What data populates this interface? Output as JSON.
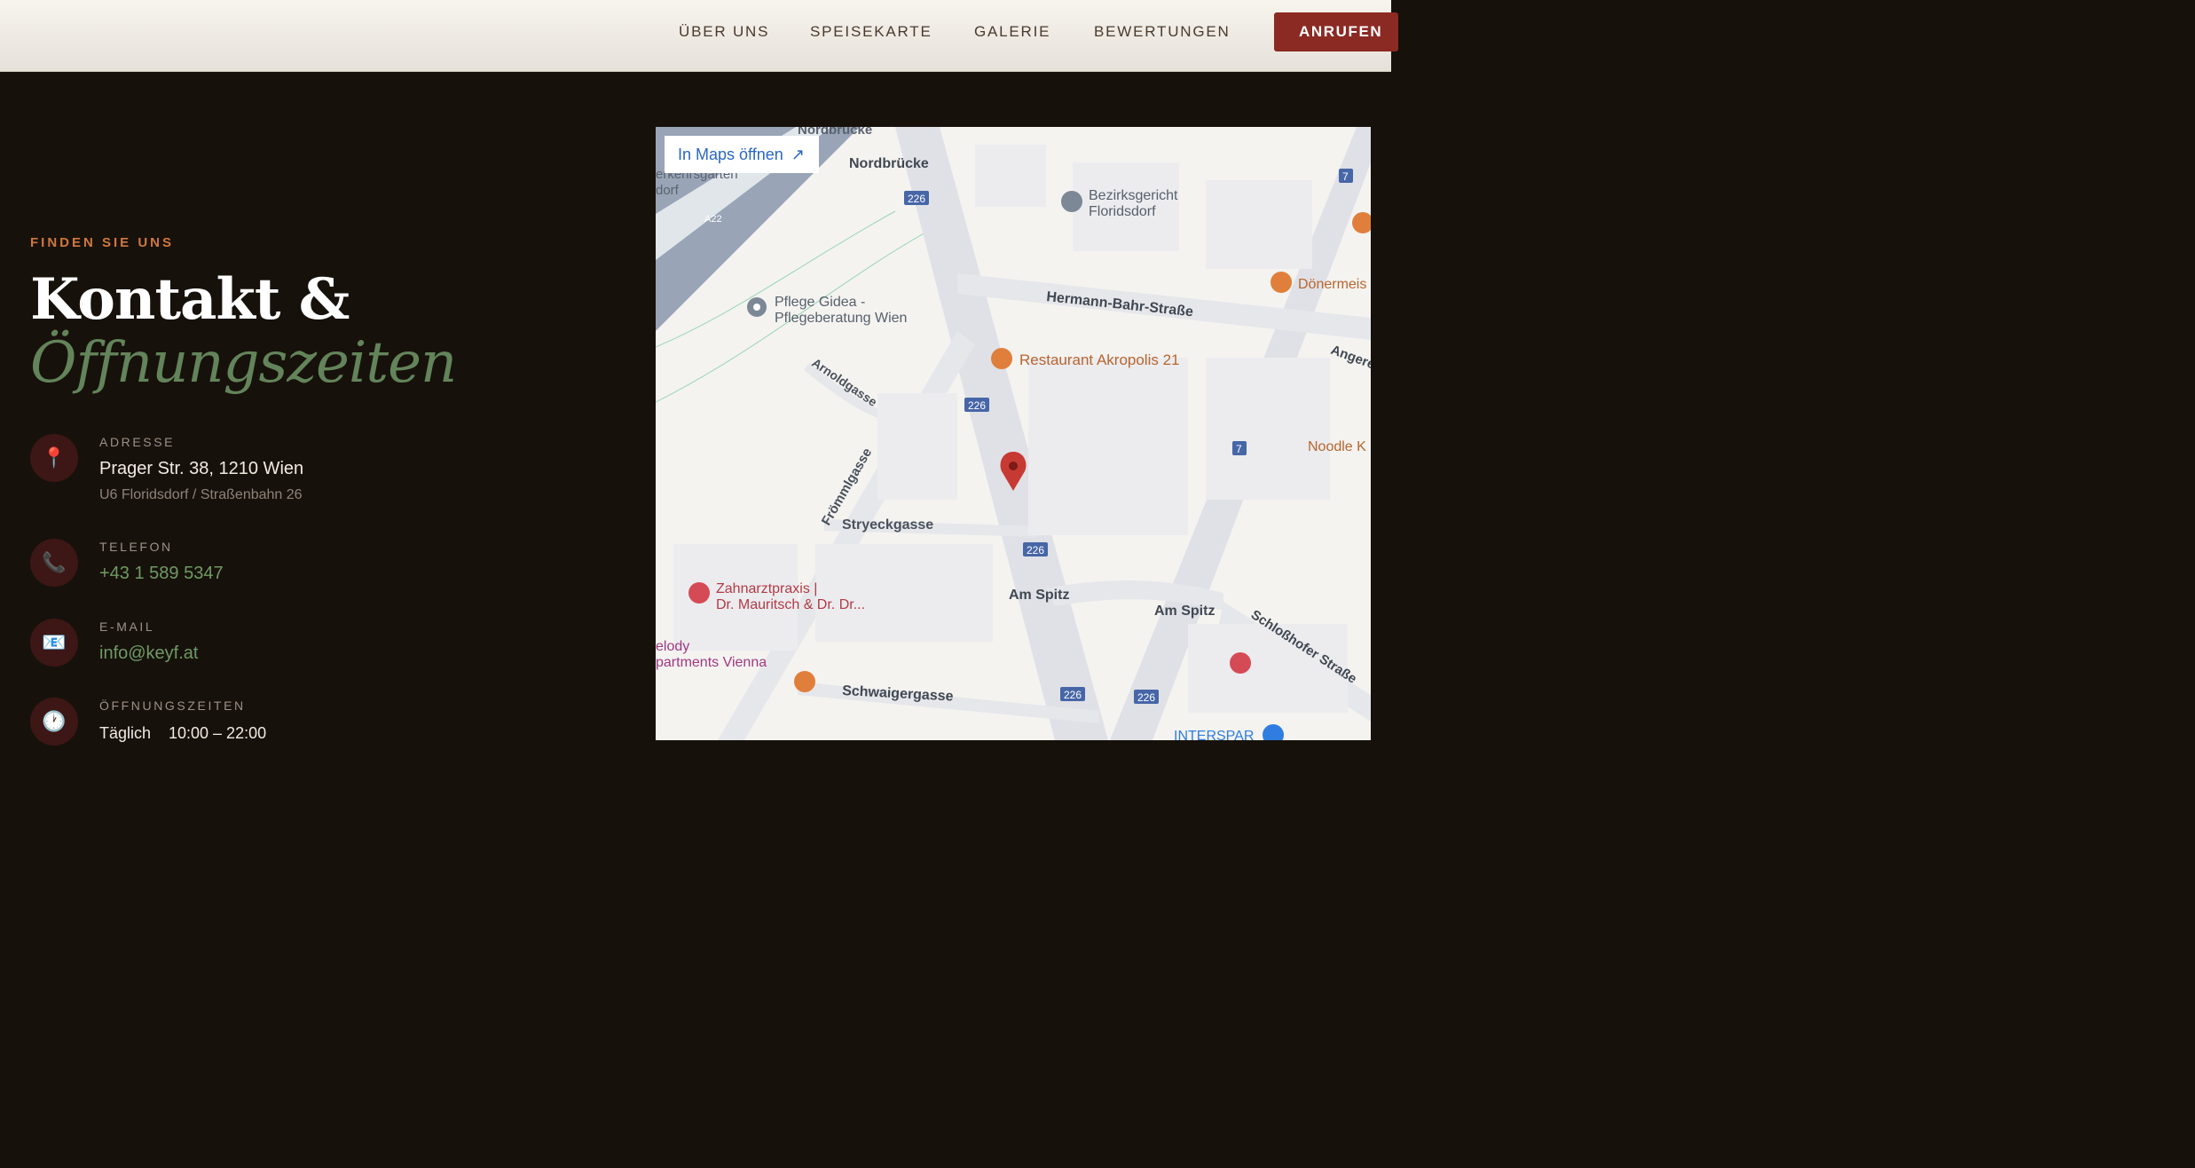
{
  "nav": {
    "items": [
      "ÜBER UNS",
      "SPEISEKARTE",
      "GALERIE",
      "BEWERTUNGEN"
    ],
    "call_label": "ANRUFEN"
  },
  "contact": {
    "eyebrow": "FINDEN SIE UNS",
    "title_main": "Kontakt &",
    "title_accent": "Öffnungszeiten",
    "address": {
      "label": "ADRESSE",
      "value": "Prager Str. 38, 1210 Wien",
      "sub": "U6 Floridsdorf / Straßenbahn 26",
      "icon": "location-pin-icon"
    },
    "phone": {
      "label": "TELEFON",
      "value": "+43 1 589 5347",
      "icon": "phone-icon"
    },
    "email": {
      "label": "E-MAIL",
      "value": "info@keyf.at",
      "icon": "email-icon"
    },
    "hours": {
      "label": "ÖFFNUNGSZEITEN",
      "day": "Täglich",
      "time": "10:00 – 22:00",
      "icon": "clock-icon"
    }
  },
  "map": {
    "open_label": "In Maps öffnen",
    "labels": [
      "Nordbrücke",
      "Nordbrücke",
      "erkehrsgarten",
      "dorf",
      "A22",
      "Bezirksgericht",
      "Floridsdorf",
      "Pflege Gidea -",
      "Pflegeberatung Wien",
      "Hermann-Bahr-Straße",
      "Restaurant Akropolis 21",
      "Dönermeis",
      "Angere",
      "Arnoldgasse",
      "Frömmlgasse",
      "Stryeckgasse",
      "Noodle K",
      "Am Spitz",
      "Am Spitz",
      "Zahnarztpraxis |",
      "Dr. Mauritsch & Dr. Dr...",
      "elody",
      "partments Vienna",
      "Schwaigergasse",
      "Schloßhofer Straße",
      "INTERSPAR"
    ],
    "route_badges": [
      "226",
      "226",
      "226",
      "226",
      "226",
      "7",
      "7"
    ]
  },
  "colors": {
    "accent": "#8b2a23",
    "green": "#63845a",
    "orange": "#d0783e",
    "background": "#17110b"
  }
}
